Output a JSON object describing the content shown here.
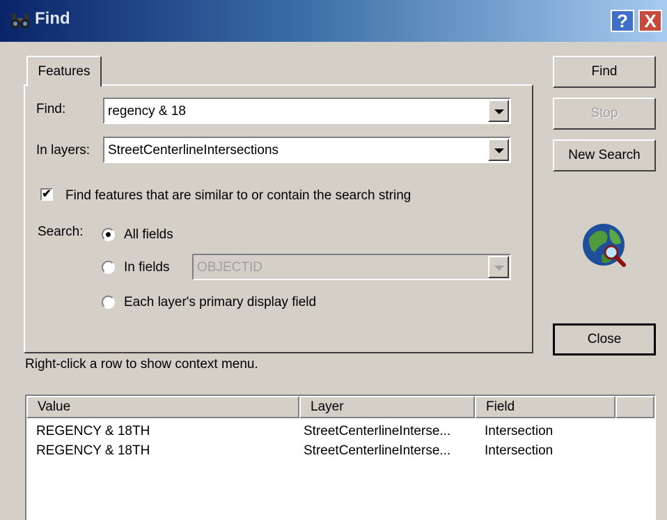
{
  "window": {
    "title": "Find",
    "help": "?",
    "close": "X"
  },
  "tab": {
    "label": "Features"
  },
  "find": {
    "label": "Find:",
    "value": "regency & 18"
  },
  "layers": {
    "label": "In layers:",
    "value": "StreetCenterlineIntersections"
  },
  "similar": {
    "label": "Find features that are similar to or contain the search string",
    "checked": true
  },
  "search": {
    "label": "Search:",
    "options": [
      {
        "label": "All fields",
        "selected": true
      },
      {
        "label": "In fields",
        "selected": false
      },
      {
        "label": "Each layer's primary display field",
        "selected": false
      }
    ],
    "field_value": "OBJECTID"
  },
  "buttons": {
    "find": "Find",
    "stop": "Stop",
    "new_search": "New Search",
    "close": "Close"
  },
  "hint": "Right-click a row to show context menu.",
  "results": {
    "columns": [
      "Value",
      "Layer",
      "Field"
    ],
    "rows": [
      [
        "REGENCY & 18TH",
        "StreetCenterlineInterse...",
        "Intersection"
      ],
      [
        "REGENCY & 18TH",
        "StreetCenterlineInterse...",
        "Intersection"
      ]
    ]
  },
  "icons": {
    "title": "binoculars-icon",
    "globe": "globe-search-icon"
  }
}
